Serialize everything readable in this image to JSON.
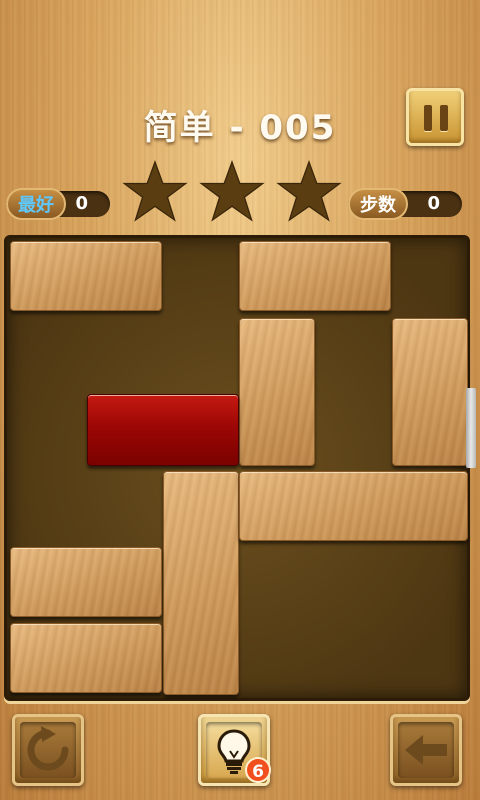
{
  "header": {
    "title": "简单 - 005"
  },
  "stats": {
    "best_label": "最好",
    "best_value": "0",
    "steps_label": "步数",
    "steps_value": "0"
  },
  "stars": {
    "earned": 0,
    "total": 3
  },
  "controls": {
    "restart_icon": "restart-icon",
    "hint_icon": "lightbulb-icon",
    "hint_count": "6",
    "back_icon": "arrow-left-icon",
    "pause_icon": "pause-icon"
  },
  "colors": {
    "target_block": "#9c0704",
    "wood_block": "#cf9a5c",
    "board_bg": "#4d3612",
    "best_label": "#5ec8ff",
    "badge": "#f24f1f"
  }
}
